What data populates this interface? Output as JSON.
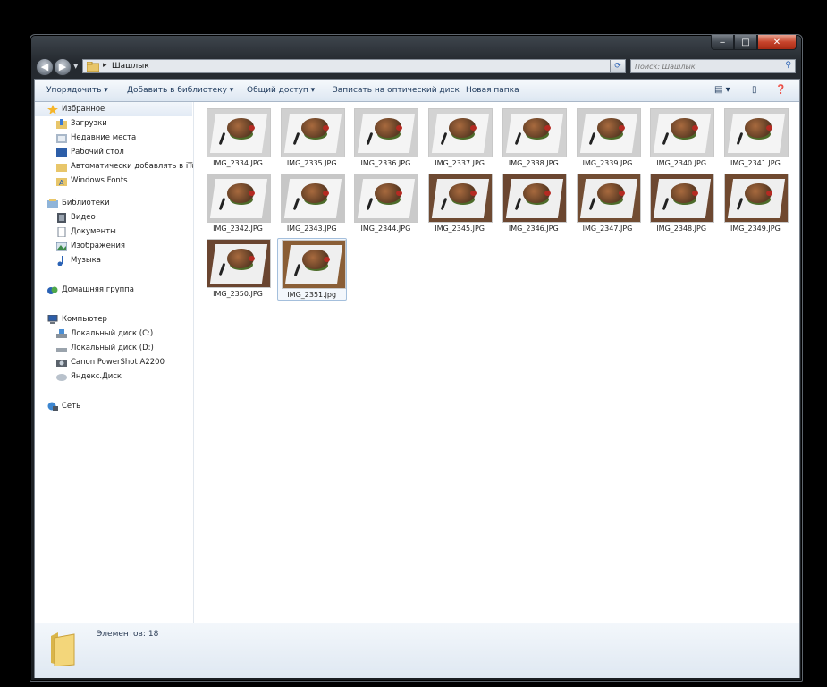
{
  "window": {
    "path_segment": "Шашлык",
    "search_placeholder": "Поиск: Шашлык"
  },
  "toolbar": {
    "organize": "Упорядочить ▾",
    "add_to_library": "Добавить в библиотеку ▾",
    "share": "Общий доступ ▾",
    "burn": "Записать на оптический диск",
    "new_folder": "Новая папка"
  },
  "sidebar": {
    "favorites": {
      "title": "Избранное",
      "items": [
        "Загрузки",
        "Недавние места",
        "Рабочий стол",
        "Автоматически добавлять в iTur",
        "Windows Fonts"
      ]
    },
    "libraries": {
      "title": "Библиотеки",
      "items": [
        "Видео",
        "Документы",
        "Изображения",
        "Музыка"
      ]
    },
    "homegroup": "Домашняя группа",
    "computer": {
      "title": "Компьютер",
      "items": [
        "Локальный диск (C:)",
        "Локальный диск (D:)",
        "Canon PowerShot A2200",
        "Яндекс.Диск"
      ]
    },
    "network": "Сеть"
  },
  "files": [
    {
      "name": "IMG_2334.JPG",
      "bg": "#d2d2d2"
    },
    {
      "name": "IMG_2335.JPG",
      "bg": "#d0d0d0"
    },
    {
      "name": "IMG_2336.JPG",
      "bg": "#cfcfcf"
    },
    {
      "name": "IMG_2337.JPG",
      "bg": "#d3d3d3"
    },
    {
      "name": "IMG_2338.JPG",
      "bg": "#d1d1d1"
    },
    {
      "name": "IMG_2339.JPG",
      "bg": "#cecece"
    },
    {
      "name": "IMG_2340.JPG",
      "bg": "#d2d2d2"
    },
    {
      "name": "IMG_2341.JPG",
      "bg": "#d0d0d0"
    },
    {
      "name": "IMG_2342.JPG",
      "bg": "#c9c9c9"
    },
    {
      "name": "IMG_2343.JPG",
      "bg": "#c7c7c7"
    },
    {
      "name": "IMG_2344.JPG",
      "bg": "#cacaca"
    },
    {
      "name": "IMG_2345.JPG",
      "bg": "#6e4a32"
    },
    {
      "name": "IMG_2346.JPG",
      "bg": "#6b4630"
    },
    {
      "name": "IMG_2347.JPG",
      "bg": "#724d33"
    },
    {
      "name": "IMG_2348.JPG",
      "bg": "#6d4831"
    },
    {
      "name": "IMG_2349.JPG",
      "bg": "#70492f"
    },
    {
      "name": "IMG_2350.JPG",
      "bg": "#6a4530"
    },
    {
      "name": "IMG_2351.jpg",
      "bg": "#8a5e36"
    }
  ],
  "status": {
    "count_label": "Элементов:",
    "count_value": "18"
  }
}
